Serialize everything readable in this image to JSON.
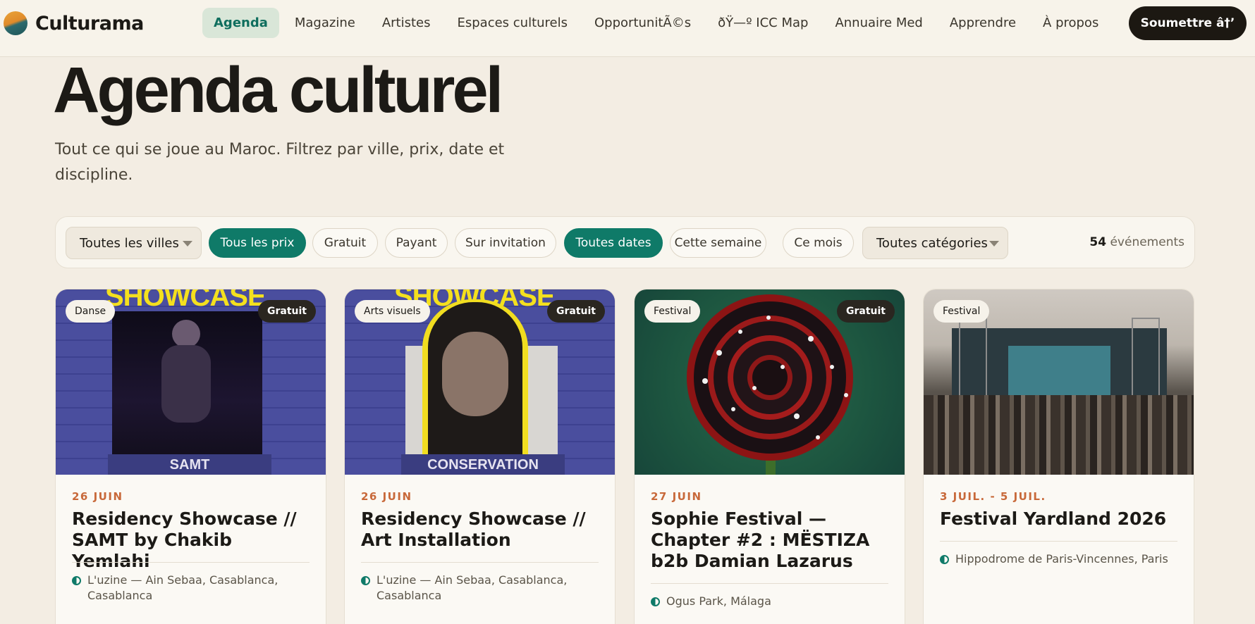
{
  "nav": {
    "brand": "Culturama",
    "links": [
      "Agenda",
      "Magazine",
      "Artistes",
      "Espaces culturels",
      "OpportunitÃ©s",
      "ðŸ—º ICC Map",
      "Annuaire Med",
      "Apprendre",
      "À propos"
    ],
    "submit_label": "Soumettre â†’"
  },
  "hero": {
    "title": "Agenda culturel",
    "subtitle": "Tout ce qui se joue au Maroc. Filtrez par ville, prix, date et discipline."
  },
  "filters": {
    "city_select": "Toutes les villes",
    "price": [
      "Tous les prix",
      "Gratuit",
      "Payant",
      "Sur invitation"
    ],
    "dates": [
      "Toutes dates",
      "Cette semaine",
      "Ce mois"
    ],
    "category_select": "Toutes catégories",
    "count_number": "54",
    "count_label": "événements"
  },
  "cards": [
    {
      "category": "Danse",
      "price": "Gratuit",
      "image_heading": "SHOWCASE",
      "image_caption": "SAMT",
      "date": "26 JUIN",
      "title": "Residency Showcase // SAMT by Chakib Yemlahi",
      "location": "L'uzine — Ain Sebaa, Casablanca, Casablanca"
    },
    {
      "category": "Arts visuels",
      "price": "Gratuit",
      "image_heading": "SHOWCASE",
      "image_caption": "CONSERVATION",
      "date": "26 JUIN",
      "title": "Residency Showcase // Art Installation",
      "location": "L'uzine — Ain Sebaa, Casablanca, Casablanca"
    },
    {
      "category": "Festival",
      "price": "Gratuit",
      "date": "27 JUIN",
      "title": "Sophie Festival — Chapter #2 : MËSTIZA b2b Damian Lazarus",
      "location": "Ogus Park, Málaga"
    },
    {
      "category": "Festival",
      "date": "3 JUIL. - 5 JUIL.",
      "title": "Festival Yardland 2026",
      "location": "Hippodrome de Paris-Vincennes, Paris"
    }
  ]
}
